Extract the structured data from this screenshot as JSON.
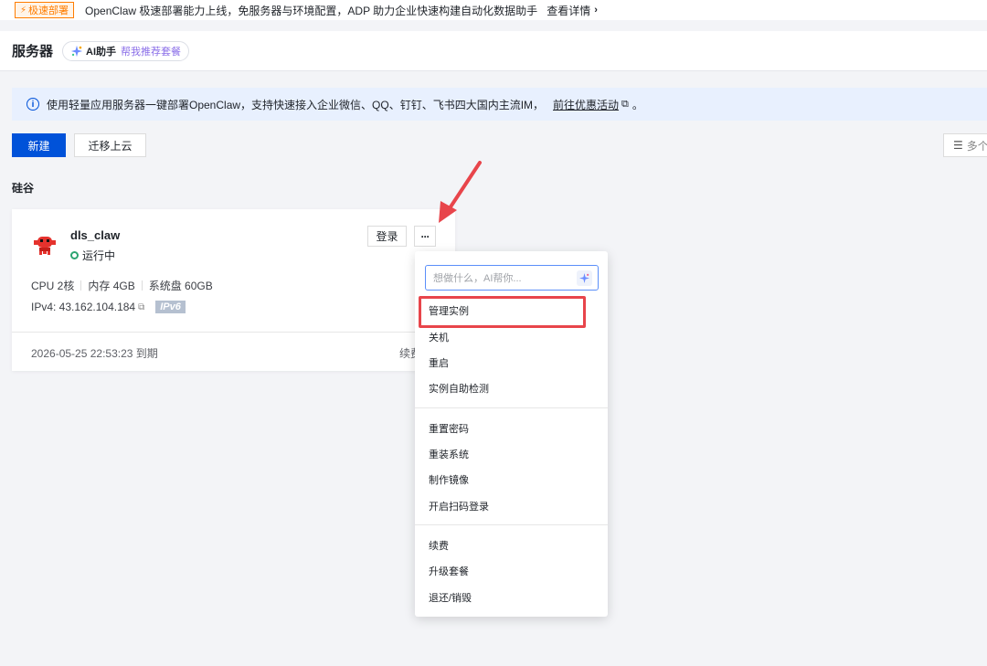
{
  "promo": {
    "tag": "极速部署",
    "text": "OpenClaw 极速部署能力上线，免服务器与环境配置，ADP 助力企业快速构建自动化数据助手",
    "link": "查看详情"
  },
  "header": {
    "title": "服务器",
    "ai_name": "AI助手",
    "ai_sub": "帮我推荐套餐"
  },
  "notice": {
    "text": "使用轻量应用服务器一键部署OpenClaw，支持快速接入企业微信、QQ、钉钉、飞书四大国内主流IM，",
    "link": "前往优惠活动",
    "period": "。"
  },
  "toolbar": {
    "new_label": "新建",
    "migrate_label": "迁移上云",
    "search_placeholder": "多个"
  },
  "region": "硅谷",
  "card": {
    "name": "dls_claw",
    "status": "运行中",
    "login_label": "登录",
    "more_label": "···",
    "specs": [
      "CPU 2核",
      "内存 4GB",
      "系统盘 60GB"
    ],
    "ipv4": "IPv4: 43.162.104.184",
    "ipv6_badge": "IPv6",
    "expiry": "2026-05-25 22:53:23 到期",
    "renew": "续费"
  },
  "menu": {
    "ai_placeholder": "想做什么，AI帮你...",
    "group1": [
      "管理实例",
      "关机",
      "重启",
      "实例自助检测"
    ],
    "group2": [
      "重置密码",
      "重装系统",
      "制作镜像",
      "开启扫码登录"
    ],
    "group3": [
      "续费",
      "升级套餐",
      "退还/销毁"
    ]
  },
  "colors": {
    "primary": "#0052d9",
    "promo_orange": "#ff7d00",
    "status_green": "#2ba471",
    "highlight_red": "#e8454b"
  }
}
